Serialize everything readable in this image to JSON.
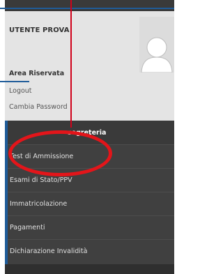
{
  "user": {
    "name": "UTENTE PROVA",
    "avatar_icon": "user-silhouette-icon"
  },
  "reserved_area": {
    "title": "Area Riservata",
    "links": [
      "Logout",
      "Cambia Password"
    ]
  },
  "menu": {
    "header": "segreteria",
    "items": [
      "Test di Ammissione",
      "Esami di Stato/PPV",
      "Immatricolazione",
      "Pagamenti",
      "Dichiarazione Invalidità"
    ]
  },
  "colors": {
    "accent_blue": "#1f5c99",
    "annotation_red": "#e3151a",
    "menu_bg": "#404040",
    "user_box_bg": "#e4e4e4"
  }
}
